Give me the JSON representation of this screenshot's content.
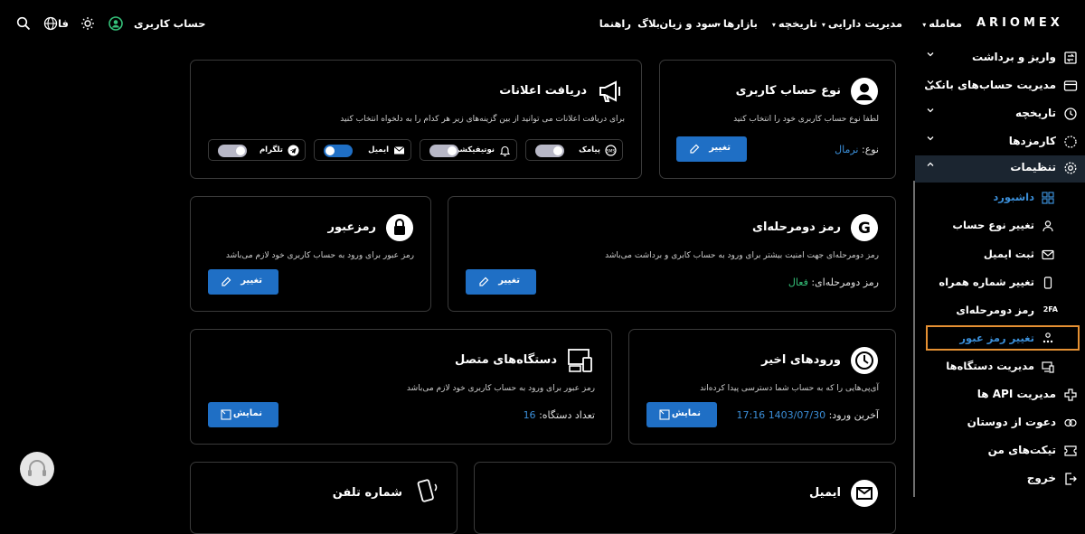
{
  "topbar": {
    "logo": "ARIOMEX",
    "nav": [
      {
        "label": "معامله",
        "caret": "▾"
      },
      {
        "label": "مدیریت دارایی",
        "caret": "▾"
      },
      {
        "label": "تاریخچه",
        "caret": "▾"
      },
      {
        "label": "بازارها",
        "caret": "▾"
      },
      {
        "label": "سود و زیان",
        "caret": ""
      },
      {
        "label": "بلاگ",
        "caret": ""
      },
      {
        "label": "راهنما",
        "caret": ""
      }
    ],
    "account": "حساب کاربری",
    "lang": "فا",
    "icons": [
      "user-circle-icon",
      "sun-icon",
      "globe-icon",
      "search-icon"
    ]
  },
  "sidebar": {
    "items": [
      {
        "label": "واریز و برداشت",
        "icon": "transfer-icon"
      },
      {
        "label": "مدیریت حساب‌های بانکی",
        "icon": "bank-card-icon"
      },
      {
        "label": "تاریخچه",
        "icon": "history-icon"
      },
      {
        "label": "کارمزدها",
        "icon": "fee-icon"
      },
      {
        "label": "تنظیمات",
        "icon": "gear-icon"
      }
    ],
    "sub_items": [
      {
        "label": "داشبورد",
        "icon": "dashboard-icon"
      },
      {
        "label": "تغییر نوع حساب",
        "icon": "user-icon"
      },
      {
        "label": "ثبت ایمیل",
        "icon": "mail-icon"
      },
      {
        "label": "تغییر شماره همراه",
        "icon": "phone-icon"
      },
      {
        "label": "رمز دومرحله‌ای",
        "icon_text": "2FA"
      },
      {
        "label": "تغییر رمز عبور",
        "icon": "password-icon"
      },
      {
        "label": "مدیریت دستگاه‌ها",
        "icon": "devices-icon"
      }
    ],
    "items_after": [
      {
        "label": "مدیریت API ها",
        "icon": "api-icon"
      },
      {
        "label": "دعوت از دوستان",
        "icon": "invite-icon"
      },
      {
        "label": "تیکت‌های من",
        "icon": "ticket-icon"
      },
      {
        "label": "خروج",
        "icon": "logout-icon"
      }
    ]
  },
  "cards": {
    "account_type": {
      "title": "نوع حساب کاربری",
      "desc": "لطفا نوع حساب کاربری خود را انتخاب کنید",
      "kv_label": "نوع:",
      "kv_value": "نرمال",
      "button": "تغییر"
    },
    "notifications": {
      "title": "دریافت اعلانات",
      "desc": "برای دریافت اعلانات می توانید از بین گزینه‌های زیر هر کدام را به دلخواه انتخاب کنید",
      "toggles": [
        {
          "label": "پیامک",
          "on": false,
          "icon": "sms-icon"
        },
        {
          "label": "نوتیفیکشن",
          "on": false,
          "icon": "bell-icon"
        },
        {
          "label": "ایمیل",
          "on": true,
          "icon": "envelope-icon"
        },
        {
          "label": "تلگرام",
          "on": false,
          "icon": "telegram-icon"
        }
      ]
    },
    "two_factor": {
      "title": "رمز دومرحله‌ای",
      "desc": "رمز دومرحله‌ای جهت امنیت بیشتر برای ورود به حساب کابری و برداشت می‌باشد",
      "kv_label": "رمز دومرحله‌ای:",
      "kv_value": "فعال",
      "button": "تغییر"
    },
    "password": {
      "title": "رمزعبور",
      "desc": "رمز عبور برای ورود به حساب کاربری خود لازم می‌باشد",
      "button": "تغییر"
    },
    "recent_logins": {
      "title": "ورودهای اخیر",
      "desc": "آی‌پی‌هایی را که به حساب شما دسترسی پیدا کرده‌اند",
      "kv_label": "آخرین ورود:",
      "kv_value": "1403/07/30 17:16",
      "button": "نمایش"
    },
    "devices": {
      "title": "دستگاه‌های متصل",
      "desc": "رمز عبور برای ورود به حساب کاربری خود لازم می‌باشد",
      "kv_label": "تعداد دستگاه:",
      "kv_value": "16",
      "button": "نمایش"
    },
    "email": {
      "title": "ایمیل"
    },
    "phone": {
      "title": "شماره تلفن"
    }
  },
  "colors": {
    "accent_blue": "#1f6fc5",
    "link_blue": "#3b8fd9",
    "active_green": "#35c27a",
    "selection_orange": "#e59033"
  }
}
